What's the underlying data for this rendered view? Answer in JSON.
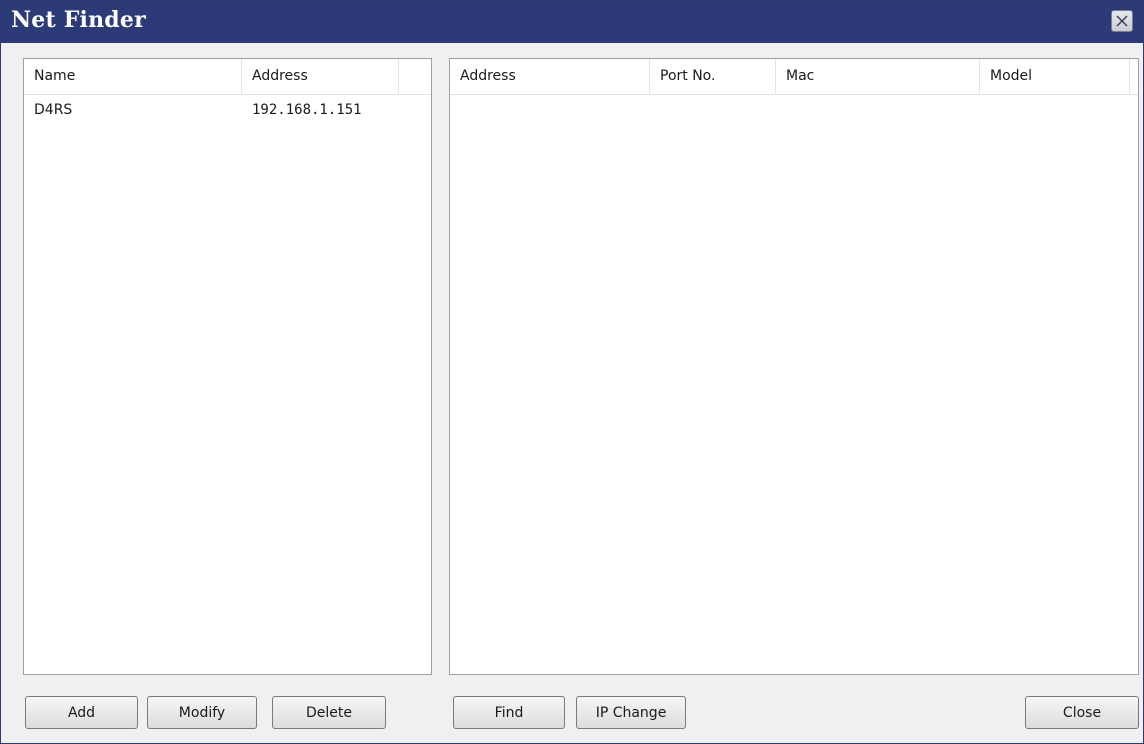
{
  "window": {
    "title": "Net Finder",
    "close_icon": "close-icon"
  },
  "left_list": {
    "columns": [
      "Name",
      "Address",
      ""
    ],
    "rows": [
      {
        "name": "D4RS",
        "address": "192.168.1.151"
      }
    ]
  },
  "right_list": {
    "columns": [
      "Address",
      "Port No.",
      "Mac",
      "Model",
      ""
    ],
    "rows": []
  },
  "buttons": {
    "add": "Add",
    "modify": "Modify",
    "delete": "Delete",
    "find": "Find",
    "ip_change": "IP Change",
    "close": "Close"
  },
  "colors": {
    "titlebar": "#2c3a78",
    "title_text": "#ffffff",
    "window_bg": "#f0f0f0"
  }
}
